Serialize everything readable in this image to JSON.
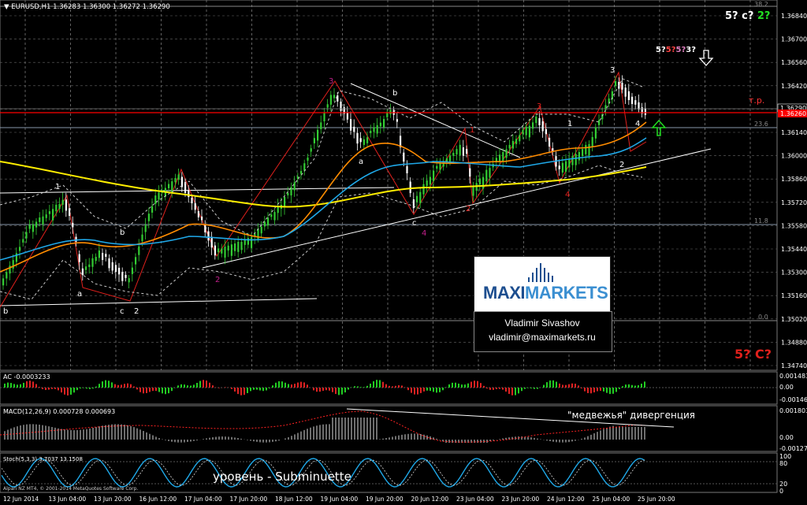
{
  "header": {
    "symbol": "▼ EURUSD,H1  1.36283 1.36300 1.36272 1.36290"
  },
  "price_axis": {
    "ticks": [
      "1.36840",
      "1.36700",
      "1.36560",
      "1.36420",
      "1.36280",
      "1.36140",
      "1.36000",
      "1.35860",
      "1.35720",
      "1.35580",
      "1.35440",
      "1.35300",
      "1.35160",
      "1.35020",
      "1.34880",
      "1.34740"
    ],
    "current_price": "1.36290",
    "level_price": "1.36260"
  },
  "fib_labels": {
    "top": "38.2",
    "mid": "23.6",
    "low": "11.8",
    "bottom": "0.0"
  },
  "annotations": {
    "tp": "т.р.",
    "corner_top": "5? c? 2?",
    "corner_top_green": "2?",
    "mid_right": "5?5?5?3?",
    "bottom_right": "5? C?",
    "divergence": "\"медвежья\" дивергенция",
    "level_note": "уровень - Subminuette"
  },
  "wave_labels": {
    "w1": "1",
    "wa": "a",
    "wb": "b",
    "wc": "c",
    "w2": "2",
    "w3": "3",
    "w4": "4",
    "wbb": "b",
    "waa": "a",
    "wc2": "c",
    "w42": "4",
    "w3b": "3",
    "w1b": "1",
    "w2b": "2",
    "w4b": "4",
    "w3c": "3",
    "w4c": "4",
    "w2c": "2",
    "w1c": "1",
    "w2d": "2",
    "wbottomb": "b"
  },
  "brand": {
    "maxi": "MAXI",
    "markets": "MARKETS",
    "author_name": "Vladimir Sivashov",
    "author_email": "vladimir@maximarkets.ru"
  },
  "subwindows": {
    "ac": {
      "label": "AC -0.0003233",
      "ticks": [
        "0.001483",
        "0.00",
        "-0.001465"
      ]
    },
    "macd": {
      "label": "MACD(12,26,9) 0.000728 0.000693",
      "ticks": [
        "0.001803",
        "0.00",
        "-0.001276"
      ]
    },
    "stoch": {
      "label": "Stoch(5,3,3) 3.7037 13.1508",
      "ticks": [
        "100",
        "80",
        "20",
        "0"
      ]
    }
  },
  "time_axis": [
    "12 Jun 2014",
    "13 Jun 04:00",
    "13 Jun 20:00",
    "16 Jun 12:00",
    "17 Jun 04:00",
    "17 Jun 20:00",
    "18 Jun 12:00",
    "19 Jun 04:00",
    "19 Jun 20:00",
    "20 Jun 12:00",
    "23 Jun 04:00",
    "23 Jun 20:00",
    "24 Jun 12:00",
    "25 Jun 04:00",
    "25 Jun 20:00"
  ],
  "copyright": "Alpari NZ MT4, © 2001-2014 MetaQuotes Software Corp.",
  "colors": {
    "grid": "#ffffff",
    "bull": "#33cc33",
    "bear": "#ffffff",
    "level": "#ff0000",
    "yellow_ma": "#ffee00",
    "orange_ma": "#ff8c00",
    "blue_ma": "#1fa8e8",
    "accent_red": "#e0201c",
    "accent_magenta": "#c0208a",
    "green_arrow": "#22dd22"
  }
}
